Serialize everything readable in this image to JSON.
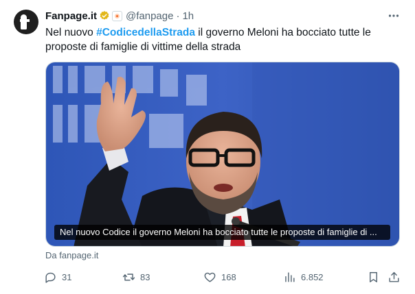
{
  "author": {
    "name": "Fanpage.it",
    "handle": "@fanpage",
    "separator": "·",
    "time": "1h"
  },
  "tweet": {
    "text_before": "Nel nuovo ",
    "hashtag": "#CodicedellaStrada",
    "text_after": "  il governo Meloni ha bocciato tutte le proposte di famiglie di vittime della strada"
  },
  "media": {
    "caption": "Nel nuovo Codice il governo Meloni ha bocciato tutte le proposte di famiglie di ..."
  },
  "source": "Da fanpage.it",
  "actions": {
    "replies": "31",
    "retweets": "83",
    "likes": "168",
    "views": "6.852"
  },
  "colors": {
    "accent": "#1d9bf0",
    "muted": "#536471",
    "verified": "#e2b719"
  },
  "icons": [
    "more-icon",
    "verified-badge-icon",
    "affiliate-badge-icon",
    "reply-icon",
    "retweet-icon",
    "like-icon",
    "views-icon",
    "bookmark-icon",
    "share-icon"
  ]
}
